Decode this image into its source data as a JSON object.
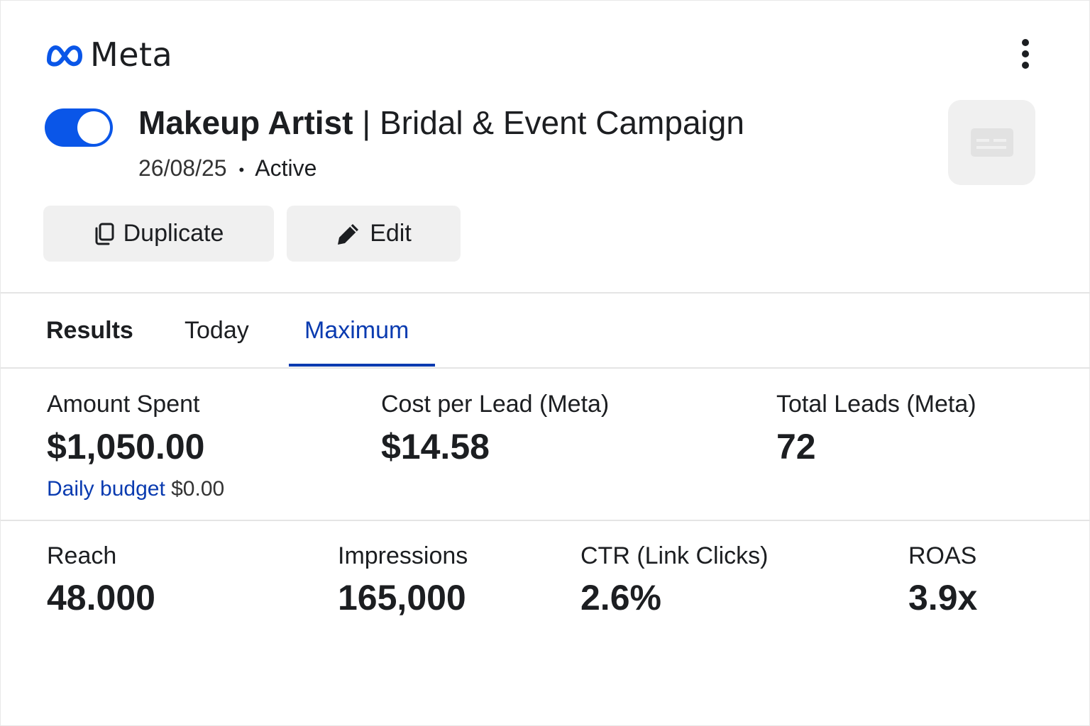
{
  "brand": {
    "name": "Meta",
    "logo_color": "#0a56e8"
  },
  "menu": {
    "icon": "more-vertical-icon"
  },
  "campaign": {
    "toggle_on": true,
    "title_bold": "Makeup Artist",
    "title_rest": " | Bridal & Event Campaign",
    "date": "26/08/25",
    "separator": "•",
    "status": "Active",
    "thumbnail_icon": "image-placeholder-icon"
  },
  "actions": {
    "duplicate_label": "Duplicate",
    "duplicate_icon": "copy-icon",
    "edit_label": "Edit",
    "edit_icon": "pencil-icon"
  },
  "tabs": {
    "section_label": "Results",
    "items": [
      {
        "label": "Today",
        "active": false
      },
      {
        "label": "Maximum",
        "active": true
      }
    ],
    "active_color": "#0a3bb0"
  },
  "metrics_primary": [
    {
      "label": "Amount Spent",
      "value": "$1,050.00"
    },
    {
      "label": "Cost per Lead (Meta)",
      "value": "$14.58"
    },
    {
      "label": "Total Leads (Meta)",
      "value": "72"
    }
  ],
  "budget": {
    "link_label": "Daily budget",
    "amount": "$0.00"
  },
  "metrics_secondary": [
    {
      "label": "Reach",
      "value": "48.000"
    },
    {
      "label": "Impressions",
      "value": "165,000"
    },
    {
      "label": "CTR (Link Clicks)",
      "value": "2.6%"
    },
    {
      "label": "ROAS",
      "value": "3.9x"
    }
  ]
}
